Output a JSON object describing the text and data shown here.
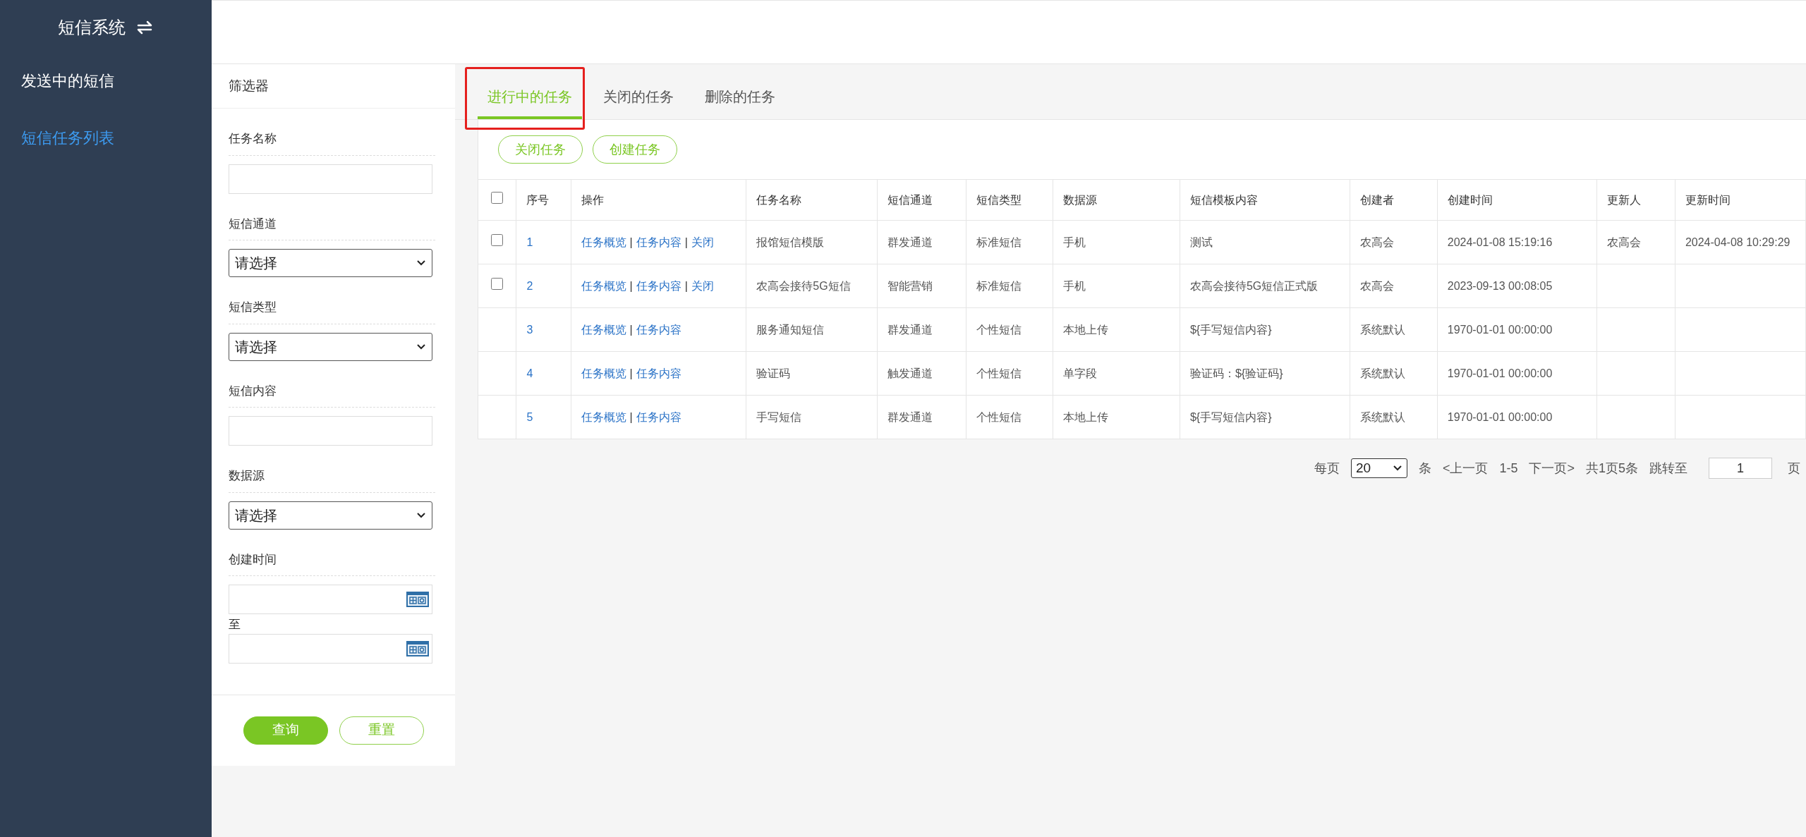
{
  "sidebar": {
    "title": "短信系统",
    "items": [
      {
        "label": "发送中的短信",
        "selected": false
      },
      {
        "label": "短信任务列表",
        "selected": true
      }
    ]
  },
  "filter": {
    "title": "筛选器",
    "fields": [
      {
        "kind": "text",
        "label": "任务名称"
      },
      {
        "kind": "select",
        "label": "短信通道",
        "value": "请选择"
      },
      {
        "kind": "select",
        "label": "短信类型",
        "value": "请选择"
      },
      {
        "kind": "text",
        "label": "短信内容"
      },
      {
        "kind": "select",
        "label": "数据源",
        "value": "请选择"
      },
      {
        "kind": "daterange",
        "label": "创建时间",
        "separator": "至"
      }
    ],
    "buttons": [
      {
        "label": "查询",
        "primary": true
      },
      {
        "label": "重置",
        "primary": false
      }
    ]
  },
  "tabs": [
    {
      "label": "进行中的任务",
      "selected": true,
      "highlighted": true
    },
    {
      "label": "关闭的任务",
      "selected": false,
      "highlighted": false
    },
    {
      "label": "删除的任务",
      "selected": false,
      "highlighted": false
    }
  ],
  "actions": [
    "关闭任务",
    "创建任务"
  ],
  "table": {
    "header_checkbox": {
      "checked": false
    },
    "columns": [
      "序号",
      "操作",
      "任务名称",
      "短信通道",
      "短信类型",
      "数据源",
      "短信模板内容",
      "创建者",
      "创建时间",
      "更新人",
      "更新时间"
    ],
    "rows": [
      {
        "checkbox": {
          "checked": false
        },
        "cells": [
          "1",
          "",
          "报馆短信模版",
          "群发通道",
          "标准短信",
          "手机",
          "测试",
          "农高会",
          "2024-01-08 15:19:16",
          "农高会",
          "2024-04-08 10:29:29"
        ],
        "links": [
          {
            "kind": "link",
            "text": "任务概览"
          },
          {
            "kind": "separator",
            "text": "|"
          },
          {
            "kind": "link",
            "text": "任务内容"
          },
          {
            "kind": "separator",
            "text": "|"
          },
          {
            "kind": "link",
            "text": "关闭"
          }
        ]
      },
      {
        "checkbox": {
          "checked": false
        },
        "cells": [
          "2",
          "",
          "农高会接待5G短信",
          "智能营销",
          "标准短信",
          "手机",
          "农高会接待5G短信正式版",
          "农高会",
          "2023-09-13 00:08:05",
          "",
          ""
        ],
        "links": [
          {
            "kind": "link",
            "text": "任务概览"
          },
          {
            "kind": "separator",
            "text": "|"
          },
          {
            "kind": "link",
            "text": "任务内容"
          },
          {
            "kind": "separator",
            "text": "|"
          },
          {
            "kind": "link",
            "text": "关闭"
          }
        ]
      },
      {
        "cells": [
          "3",
          "",
          "服务通知短信",
          "群发通道",
          "个性短信",
          "本地上传",
          "${手写短信内容}",
          "系统默认",
          "1970-01-01 00:00:00",
          "",
          ""
        ],
        "links": [
          {
            "kind": "link",
            "text": "任务概览"
          },
          {
            "kind": "separator",
            "text": "|"
          },
          {
            "kind": "link",
            "text": "任务内容"
          }
        ]
      },
      {
        "cells": [
          "4",
          "",
          "验证码",
          "触发通道",
          "个性短信",
          "单字段",
          "验证码：${验证码}",
          "系统默认",
          "1970-01-01 00:00:00",
          "",
          ""
        ],
        "links": [
          {
            "kind": "link",
            "text": "任务概览"
          },
          {
            "kind": "separator",
            "text": "|"
          },
          {
            "kind": "link",
            "text": "任务内容"
          }
        ]
      },
      {
        "cells": [
          "5",
          "",
          "手写短信",
          "群发通道",
          "个性短信",
          "本地上传",
          "${手写短信内容}",
          "系统默认",
          "1970-01-01 00:00:00",
          "",
          ""
        ],
        "links": [
          {
            "kind": "link",
            "text": "任务概览"
          },
          {
            "kind": "separator",
            "text": "|"
          },
          {
            "kind": "link",
            "text": "任务内容"
          }
        ]
      }
    ]
  },
  "pagination": {
    "per_page_label": "每页",
    "per_page": "20",
    "unit": "条",
    "prev": "<上一页",
    "range": "1-5",
    "next": "下一页>",
    "total": "共1页5条",
    "jump_label": "跳转至",
    "page": "1",
    "page_unit": "页"
  }
}
